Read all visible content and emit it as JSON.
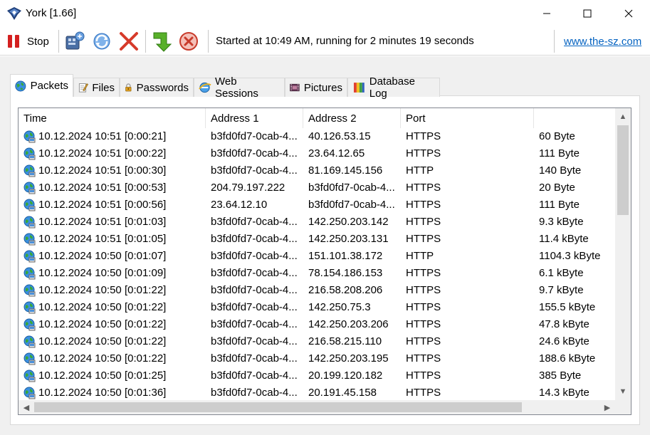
{
  "window": {
    "title": "York [1.66]",
    "controls": {
      "minimize": "minimize",
      "maximize": "maximize",
      "close": "close"
    }
  },
  "toolbar": {
    "stop_label": "Stop",
    "status": "Started at 10:49 AM, running for 2 minutes 19 seconds",
    "link": "www.the-sz.com"
  },
  "tabs": [
    {
      "label": "Packets",
      "icon": "globe-icon",
      "active": true
    },
    {
      "label": "Files",
      "icon": "document-pen-icon",
      "active": false
    },
    {
      "label": "Passwords",
      "icon": "padlock-icon",
      "active": false
    },
    {
      "label": "Web Sessions",
      "icon": "browser-icon",
      "active": false
    },
    {
      "label": "Pictures",
      "icon": "film-icon",
      "active": false
    },
    {
      "label": "Database Log",
      "icon": "database-icon",
      "active": false
    }
  ],
  "table": {
    "columns": [
      "Time",
      "Address 1",
      "Address 2",
      "Port",
      ""
    ],
    "rows": [
      [
        "10.12.2024 10:51 [0:00:21]",
        "b3fd0fd7-0cab-4...",
        "40.126.53.15",
        "HTTPS",
        "60 Byte"
      ],
      [
        "10.12.2024 10:51 [0:00:22]",
        "b3fd0fd7-0cab-4...",
        "23.64.12.65",
        "HTTPS",
        "111 Byte"
      ],
      [
        "10.12.2024 10:51 [0:00:30]",
        "b3fd0fd7-0cab-4...",
        "81.169.145.156",
        "HTTP",
        "140 Byte"
      ],
      [
        "10.12.2024 10:51 [0:00:53]",
        "204.79.197.222",
        "b3fd0fd7-0cab-4...",
        "HTTPS",
        "20 Byte"
      ],
      [
        "10.12.2024 10:51 [0:00:56]",
        "23.64.12.10",
        "b3fd0fd7-0cab-4...",
        "HTTPS",
        "111 Byte"
      ],
      [
        "10.12.2024 10:51 [0:01:03]",
        "b3fd0fd7-0cab-4...",
        "142.250.203.142",
        "HTTPS",
        "9.3 kByte"
      ],
      [
        "10.12.2024 10:51 [0:01:05]",
        "b3fd0fd7-0cab-4...",
        "142.250.203.131",
        "HTTPS",
        "11.4 kByte"
      ],
      [
        "10.12.2024 10:50 [0:01:07]",
        "b3fd0fd7-0cab-4...",
        "151.101.38.172",
        "HTTP",
        "1104.3 kByte"
      ],
      [
        "10.12.2024 10:50 [0:01:09]",
        "b3fd0fd7-0cab-4...",
        "78.154.186.153",
        "HTTPS",
        "6.1 kByte"
      ],
      [
        "10.12.2024 10:50 [0:01:22]",
        "b3fd0fd7-0cab-4...",
        "216.58.208.206",
        "HTTPS",
        "9.7 kByte"
      ],
      [
        "10.12.2024 10:50 [0:01:22]",
        "b3fd0fd7-0cab-4...",
        "142.250.75.3",
        "HTTPS",
        "155.5 kByte"
      ],
      [
        "10.12.2024 10:50 [0:01:22]",
        "b3fd0fd7-0cab-4...",
        "142.250.203.206",
        "HTTPS",
        "47.8 kByte"
      ],
      [
        "10.12.2024 10:50 [0:01:22]",
        "b3fd0fd7-0cab-4...",
        "216.58.215.110",
        "HTTPS",
        "24.6 kByte"
      ],
      [
        "10.12.2024 10:50 [0:01:22]",
        "b3fd0fd7-0cab-4...",
        "142.250.203.195",
        "HTTPS",
        "188.6 kByte"
      ],
      [
        "10.12.2024 10:50 [0:01:25]",
        "b3fd0fd7-0cab-4...",
        "20.199.120.182",
        "HTTPS",
        "385 Byte"
      ],
      [
        "10.12.2024 10:50 [0:01:36]",
        "b3fd0fd7-0cab-4...",
        "20.191.45.158",
        "HTTPS",
        "14.3 kByte"
      ]
    ]
  },
  "colors": {
    "link": "#0563c1",
    "stop_red": "#d42020",
    "background": "#f0f0f0"
  }
}
